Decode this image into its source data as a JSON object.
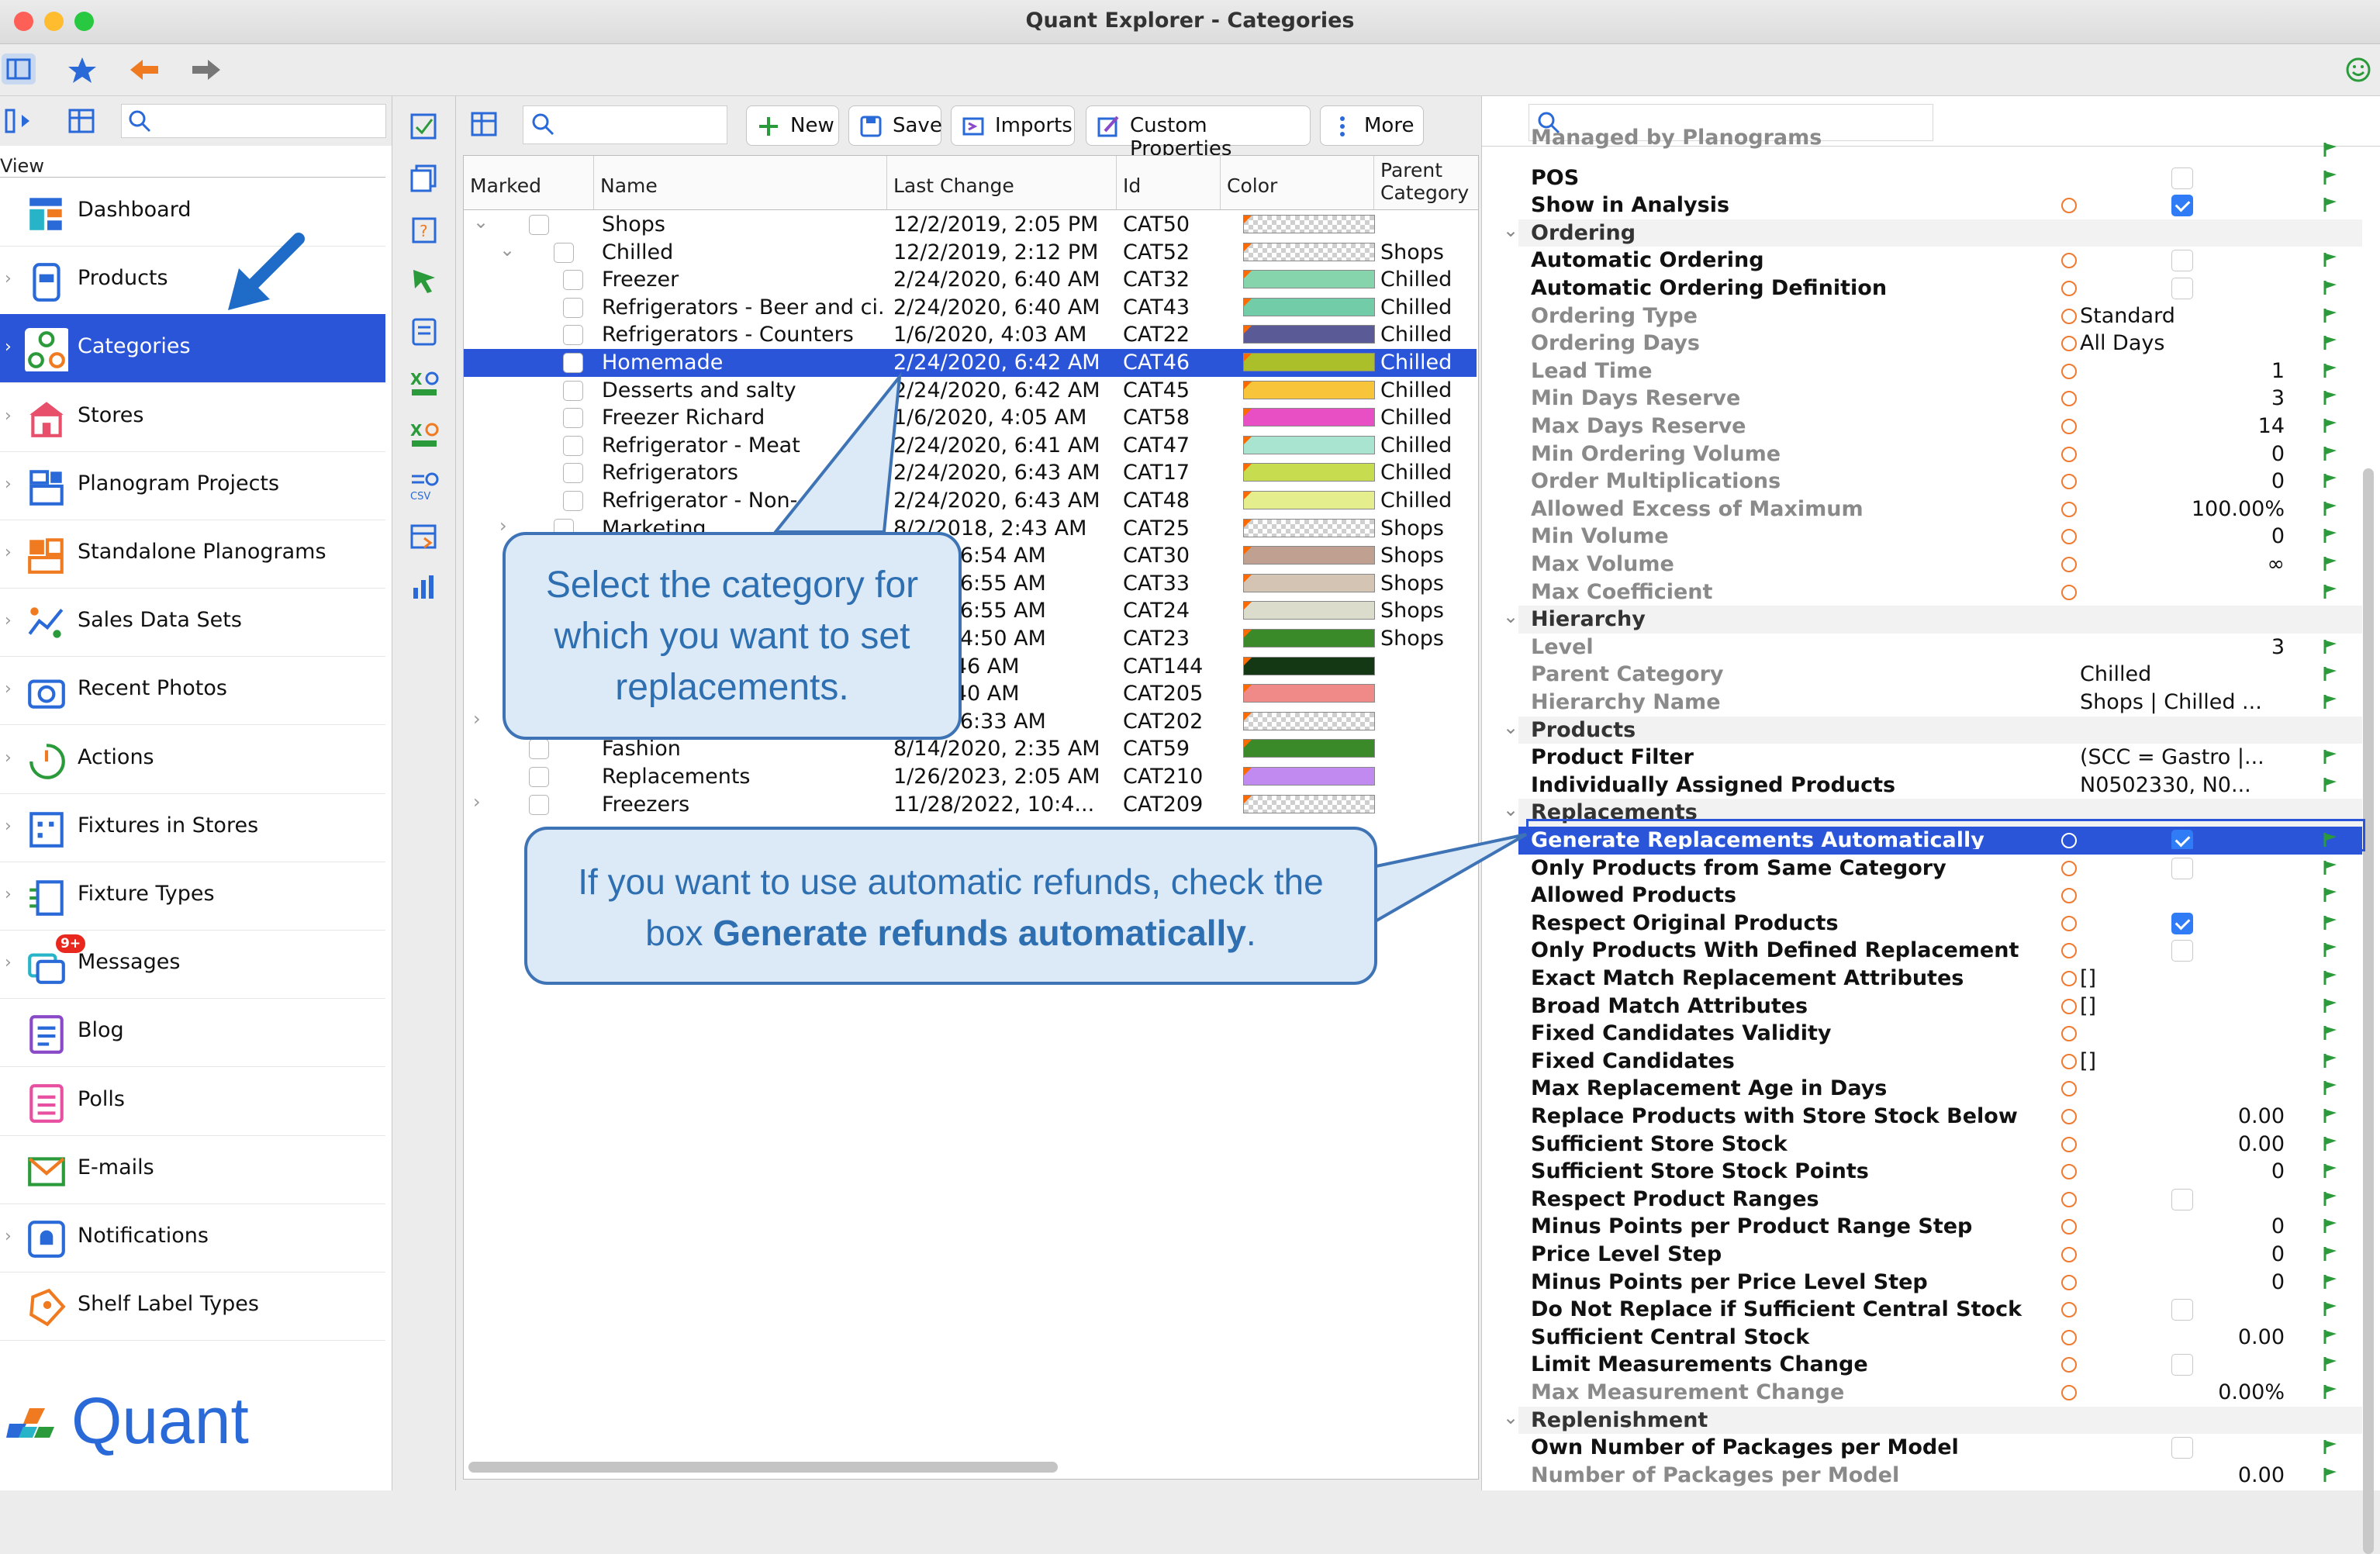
{
  "window": {
    "title": "Quant Explorer - Categories"
  },
  "sidebar": {
    "view_label": "View",
    "items": [
      {
        "label": "Dashboard",
        "icon": "dashboard-icon"
      },
      {
        "label": "Products",
        "icon": "products-icon"
      },
      {
        "label": "Categories",
        "icon": "categories-icon",
        "selected": true
      },
      {
        "label": "Stores",
        "icon": "stores-icon"
      },
      {
        "label": "Planogram Projects",
        "icon": "planogram-projects-icon"
      },
      {
        "label": "Standalone Planograms",
        "icon": "standalone-planograms-icon"
      },
      {
        "label": "Sales Data Sets",
        "icon": "sales-data-icon"
      },
      {
        "label": "Recent Photos",
        "icon": "camera-icon"
      },
      {
        "label": "Actions",
        "icon": "actions-icon"
      },
      {
        "label": "Fixtures in Stores",
        "icon": "fixtures-icon"
      },
      {
        "label": "Fixture Types",
        "icon": "fixture-types-icon"
      },
      {
        "label": "Messages",
        "icon": "messages-icon",
        "badge": "9+"
      },
      {
        "label": "Blog",
        "icon": "blog-icon"
      },
      {
        "label": "Polls",
        "icon": "polls-icon"
      },
      {
        "label": "E-mails",
        "icon": "email-icon"
      },
      {
        "label": "Notifications",
        "icon": "notifications-icon"
      },
      {
        "label": "Shelf Label Types",
        "icon": "shelf-label-icon"
      }
    ],
    "logo_text": "Quant"
  },
  "toolbar": {
    "new_label": "New",
    "save_label": "Save",
    "imports_label": "Imports",
    "custom_properties_label": "Custom Properties",
    "more_label": "More"
  },
  "table": {
    "columns": [
      "Marked",
      "Name",
      "Last Change",
      "Id",
      "Color",
      "Parent Category"
    ],
    "rows": [
      {
        "name": "Shops",
        "last_change": "12/2/2019, 2:05 PM",
        "id": "CAT50",
        "color": "#e8e8e8",
        "parent": "",
        "checker": true
      },
      {
        "name": "Chilled",
        "last_change": "12/2/2019, 2:12 PM",
        "id": "CAT52",
        "color": "#e8e8e8",
        "parent": "Shops",
        "checker": true
      },
      {
        "name": "Freezer",
        "last_change": "2/24/2020, 6:40 AM",
        "id": "CAT32",
        "color": "#86d4ac",
        "parent": "Chilled"
      },
      {
        "name": "Refrigerators - Beer and ci...",
        "last_change": "2/24/2020, 6:40 AM",
        "id": "CAT43",
        "color": "#72cca8",
        "parent": "Chilled"
      },
      {
        "name": "Refrigerators - Counters",
        "last_change": "1/6/2020, 4:03 AM",
        "id": "CAT22",
        "color": "#5a5a96",
        "parent": "Chilled"
      },
      {
        "name": "Homemade",
        "last_change": "2/24/2020, 6:42 AM",
        "id": "CAT46",
        "color": "#aabf2a",
        "parent": "Chilled",
        "selected": true
      },
      {
        "name": "Desserts and salty",
        "last_change": "2/24/2020, 6:42 AM",
        "id": "CAT45",
        "color": "#f7c43a",
        "parent": "Chilled"
      },
      {
        "name": "Freezer Richard",
        "last_change": "1/6/2020, 4:05 AM",
        "id": "CAT58",
        "color": "#e84fc4",
        "parent": "Chilled"
      },
      {
        "name": "Refrigerator - Meat",
        "last_change": "2/24/2020, 6:41 AM",
        "id": "CAT47",
        "color": "#a8e4d0",
        "parent": "Chilled"
      },
      {
        "name": "Refrigerators",
        "last_change": "2/24/2020, 6:43 AM",
        "id": "CAT17",
        "color": "#c8dc50",
        "parent": "Chilled"
      },
      {
        "name": "Refrigerator - Non-...",
        "last_change": "2/24/2020, 6:43 AM",
        "id": "CAT48",
        "color": "#e4ee8c",
        "parent": "Chilled"
      },
      {
        "name": "Marketing",
        "last_change": "8/2/2018, 2:43 AM",
        "id": "CAT25",
        "color": "#e8e8e8",
        "parent": "Shops",
        "checker": true
      },
      {
        "name": "",
        "last_change": "2020, 6:54 AM",
        "id": "CAT30",
        "color": "#c0a090",
        "parent": "Shops"
      },
      {
        "name": "",
        "last_change": "2020, 6:55 AM",
        "id": "CAT33",
        "color": "#d4c4b4",
        "parent": "Shops"
      },
      {
        "name": "",
        "last_change": "2020, 6:55 AM",
        "id": "CAT24",
        "color": "#dcdccc",
        "parent": "Shops"
      },
      {
        "name": "",
        "last_change": "2022, 4:50 AM",
        "id": "CAT23",
        "color": "#3a8a2a",
        "parent": "Shops"
      },
      {
        "name": "",
        "last_change": "21, 7:46 AM",
        "id": "CAT144",
        "color": "#143814",
        "parent": ""
      },
      {
        "name": "",
        "last_change": "22, 3:40 AM",
        "id": "CAT205",
        "color": "#f08a88",
        "parent": ""
      },
      {
        "name": "",
        "last_change": "2022, 6:33 AM",
        "id": "CAT202",
        "color": "#e8e8e8",
        "parent": "",
        "checker": true
      },
      {
        "name": "Fashion",
        "last_change": "8/14/2020, 2:35 AM",
        "id": "CAT59",
        "color": "#3a8a2a",
        "parent": ""
      },
      {
        "name": "Replacements",
        "last_change": "1/26/2023, 2:05 AM",
        "id": "CAT210",
        "color": "#c08af0",
        "parent": ""
      },
      {
        "name": "Freezers",
        "last_change": "11/28/2022, 10:4...",
        "id": "CAT209",
        "color": "#e8e8e8",
        "parent": "",
        "checker": true
      }
    ]
  },
  "properties": {
    "rows": [
      {
        "label": "Managed by Planograms",
        "kind": "grey",
        "partial": true
      },
      {
        "label": "POS",
        "kind": "normal",
        "check": "off"
      },
      {
        "label": "Show in Analysis",
        "kind": "normal",
        "check": "on",
        "origin": true
      },
      {
        "label": "Ordering",
        "kind": "section"
      },
      {
        "label": "Automatic Ordering",
        "kind": "normal",
        "check": "off",
        "origin": true
      },
      {
        "label": "Automatic Ordering Definition",
        "kind": "normal",
        "check": "off",
        "origin": true
      },
      {
        "label": "Ordering Type",
        "kind": "grey",
        "value": "Standard",
        "origin": true
      },
      {
        "label": "Ordering Days",
        "kind": "grey",
        "value": "All Days",
        "origin": true
      },
      {
        "label": "Lead Time",
        "kind": "grey",
        "num": "1",
        "origin": true
      },
      {
        "label": "Min Days Reserve",
        "kind": "grey",
        "num": "3",
        "origin": true
      },
      {
        "label": "Max Days Reserve",
        "kind": "grey",
        "num": "14",
        "origin": true
      },
      {
        "label": "Min Ordering Volume",
        "kind": "grey",
        "num": "0",
        "origin": true
      },
      {
        "label": "Order Multiplications",
        "kind": "grey",
        "num": "0",
        "origin": true
      },
      {
        "label": "Allowed Excess of Maximum",
        "kind": "grey",
        "num": "100.00%",
        "origin": true
      },
      {
        "label": "Min Volume",
        "kind": "grey",
        "num": "0",
        "origin": true
      },
      {
        "label": "Max Volume",
        "kind": "grey",
        "num": "∞",
        "origin": true
      },
      {
        "label": "Max Coefficient",
        "kind": "grey",
        "origin": true
      },
      {
        "label": "Hierarchy",
        "kind": "section"
      },
      {
        "label": "Level",
        "kind": "grey",
        "num": "3"
      },
      {
        "label": "Parent Category",
        "kind": "grey",
        "value": "Chilled"
      },
      {
        "label": "Hierarchy Name",
        "kind": "grey",
        "value": "Shops | Chilled ..."
      },
      {
        "label": "Products",
        "kind": "section"
      },
      {
        "label": "Product Filter",
        "kind": "normal",
        "value": "(SCC = Gastro |..."
      },
      {
        "label": "Individually Assigned Products",
        "kind": "normal",
        "value": "N0502330, N0..."
      },
      {
        "label": "Replacements",
        "kind": "section"
      },
      {
        "label": "Generate Replacements Automatically",
        "kind": "selected",
        "check": "on",
        "origin": true
      },
      {
        "label": "Only Products from Same Category",
        "kind": "normal",
        "check": "off",
        "origin": true
      },
      {
        "label": "Allowed Products",
        "kind": "normal",
        "origin": true
      },
      {
        "label": "Respect Original Products",
        "kind": "normal",
        "check": "on",
        "origin": true
      },
      {
        "label": "Only Products With Defined Replacement",
        "kind": "normal",
        "check": "off",
        "origin": true
      },
      {
        "label": "Exact Match Replacement Attributes",
        "kind": "normal",
        "value": "[]",
        "origin": true
      },
      {
        "label": "Broad Match Attributes",
        "kind": "normal",
        "value": "[]",
        "origin": true
      },
      {
        "label": "Fixed Candidates Validity",
        "kind": "normal",
        "origin": true
      },
      {
        "label": "Fixed Candidates",
        "kind": "normal",
        "value": "[]",
        "origin": true
      },
      {
        "label": "Max Replacement Age in Days",
        "kind": "normal",
        "origin": true
      },
      {
        "label": "Replace Products with Store Stock Below",
        "kind": "normal",
        "num": "0.00",
        "origin": true
      },
      {
        "label": "Sufficient Store Stock",
        "kind": "normal",
        "num": "0.00",
        "origin": true
      },
      {
        "label": "Sufficient Store Stock Points",
        "kind": "normal",
        "num": "0",
        "origin": true
      },
      {
        "label": "Respect Product Ranges",
        "kind": "normal",
        "check": "off",
        "origin": true
      },
      {
        "label": "Minus Points per Product Range Step",
        "kind": "normal",
        "num": "0",
        "origin": true
      },
      {
        "label": "Price Level Step",
        "kind": "normal",
        "num": "0",
        "origin": true
      },
      {
        "label": "Minus Points per Price Level Step",
        "kind": "normal",
        "num": "0",
        "origin": true
      },
      {
        "label": "Do Not Replace if Sufficient Central Stock",
        "kind": "normal",
        "check": "off",
        "origin": true
      },
      {
        "label": "Sufficient Central Stock",
        "kind": "normal",
        "num": "0.00",
        "origin": true
      },
      {
        "label": "Limit Measurements Change",
        "kind": "normal",
        "check": "off",
        "origin": true
      },
      {
        "label": "Max Measurement Change",
        "kind": "grey",
        "num": "0.00%",
        "origin": true
      },
      {
        "label": "Replenishment",
        "kind": "section"
      },
      {
        "label": "Own Number of Packages per Model",
        "kind": "normal",
        "check": "off"
      },
      {
        "label": "Number of Packages per Model",
        "kind": "grey",
        "num": "0.00"
      }
    ]
  },
  "callouts": {
    "select_category": "Select the category for which you want to set replacements.",
    "refunds_prefix": "If you want to use automatic refunds, check the box ",
    "refunds_bold": "Generate refunds automatically",
    "refunds_suffix": "."
  },
  "colors": {
    "selection": "#2a55d8",
    "callout_border": "#3e74b6",
    "callout_fill": "#dce9f7",
    "arrow": "#1f6cc8"
  }
}
